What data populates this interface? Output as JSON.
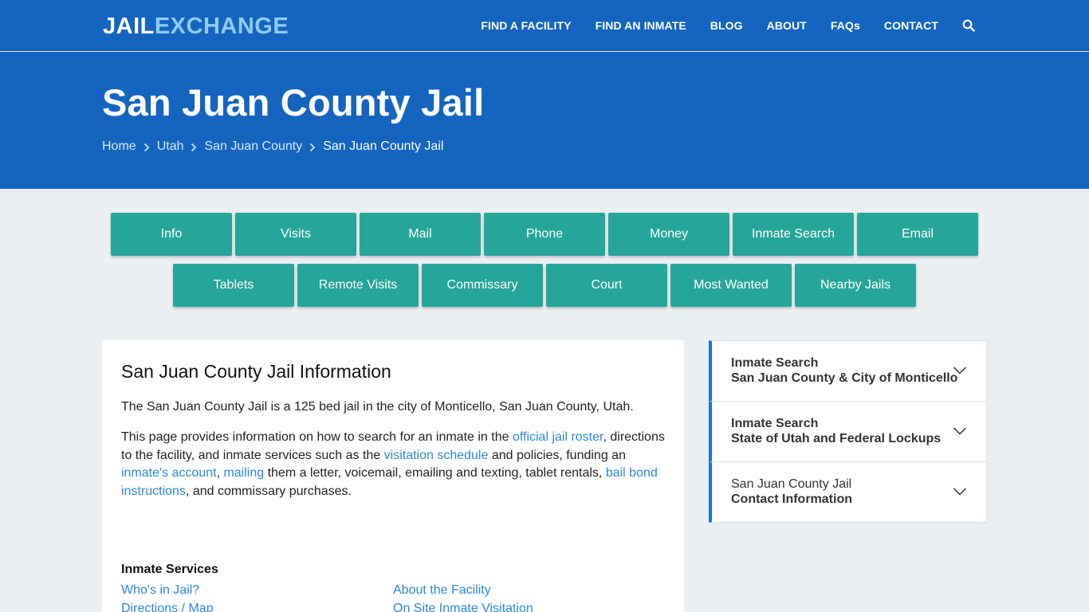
{
  "logo": {
    "part1": "JAIL",
    "part2": "EXCHANGE"
  },
  "nav": [
    {
      "label": "FIND A FACILITY"
    },
    {
      "label": "FIND AN INMATE"
    },
    {
      "label": "BLOG"
    },
    {
      "label": "ABOUT"
    },
    {
      "label": "FAQs"
    },
    {
      "label": "CONTACT"
    }
  ],
  "hero": {
    "title": "San Juan County Jail",
    "breadcrumb": [
      "Home",
      "Utah",
      "San Juan County",
      "San Juan County Jail"
    ]
  },
  "buttons_row1": [
    "Info",
    "Visits",
    "Mail",
    "Phone",
    "Money",
    "Inmate Search",
    "Email"
  ],
  "buttons_row2": [
    "Tablets",
    "Remote Visits",
    "Commissary",
    "Court",
    "Most Wanted",
    "Nearby Jails"
  ],
  "main": {
    "heading": "San Juan County Jail Information",
    "para1": "The San Juan County Jail is a 125 bed jail in the city of Monticello, San Juan County, Utah.",
    "para2": {
      "t1": "This page provides information on how to search for an inmate in the ",
      "l1": "official jail roster",
      "t2": ", directions to the facility, and inmate services such as the ",
      "l2": "visitation schedule",
      "t3": " and policies, funding an ",
      "l3": "inmate's account",
      "t4": ", ",
      "l4": "mailing",
      "t5": " them a letter, voicemail, emailing and texting, tablet rentals, ",
      "l5": "bail bond instructions",
      "t6": ", and commissary purchases."
    },
    "services_heading": "Inmate Services",
    "services_left": [
      "Who's in Jail?",
      "Directions / Map"
    ],
    "services_right": [
      "About the Facility",
      "On Site Inmate Visitation"
    ]
  },
  "sidebar": [
    {
      "line1": "Inmate Search",
      "line2": "San Juan County & City of Monticello"
    },
    {
      "line1": "Inmate Search",
      "line2": "State of Utah and Federal Lockups"
    },
    {
      "line1": "San Juan County Jail",
      "line2": "Contact Information"
    }
  ],
  "colors": {
    "header": "#1565c0",
    "button": "#26a69a",
    "link": "#2e86de",
    "accent": "#1976d2",
    "background": "#eceff1"
  }
}
